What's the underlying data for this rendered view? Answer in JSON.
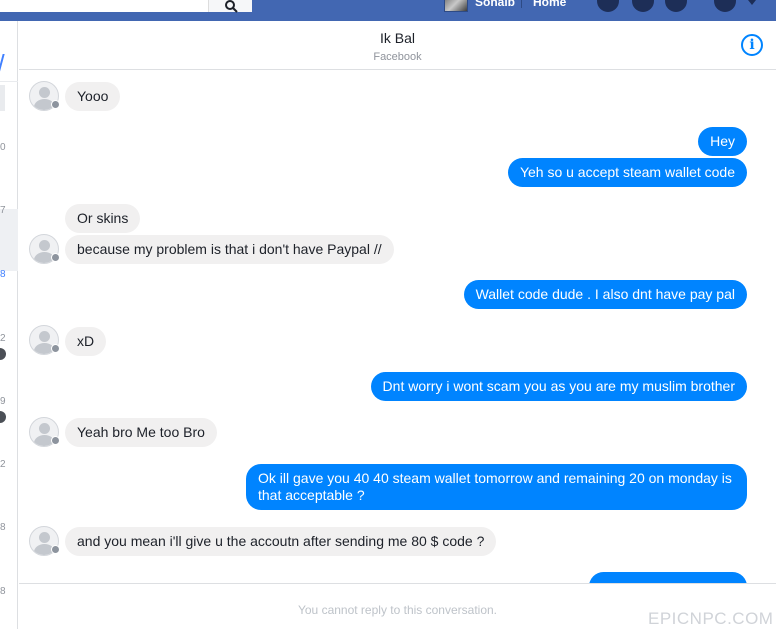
{
  "topbar": {
    "user_name": "Sohaib",
    "home_label": "Home"
  },
  "leftstrip": {
    "numbers": [
      "0",
      "7",
      "8",
      "2",
      "9",
      "2",
      "8",
      "8"
    ]
  },
  "conversation": {
    "contact_name": "Ik Bal",
    "contact_subtitle": "Facebook",
    "info_icon": "i"
  },
  "messages": [
    {
      "direction": "in",
      "text": "Yooo"
    },
    {
      "direction": "out",
      "text": "Hey"
    },
    {
      "direction": "out",
      "text": "Yeh so u accept steam wallet code"
    },
    {
      "direction": "in",
      "text": "Or skins"
    },
    {
      "direction": "in",
      "text": "because my problem is that i don't have Paypal //"
    },
    {
      "direction": "out",
      "text": "Wallet code dude . I also dnt have pay pal"
    },
    {
      "direction": "in",
      "text": "xD"
    },
    {
      "direction": "out",
      "text": "Dnt worry i wont scam you as you are my muslim brother"
    },
    {
      "direction": "in",
      "text": "Yeah bro Me too Bro"
    },
    {
      "direction": "out",
      "text": "Ok ill gave you 40 40 steam wallet tomorrow and remaining 20 on monday is that acceptable ?"
    },
    {
      "direction": "in",
      "text": "and you mean i'll give u the accoutn after sending me 80 $ code ?"
    }
  ],
  "footer": {
    "notice": "You cannot reply to this conversation."
  },
  "watermark": "EPICNPC.COM",
  "colors": {
    "fb_blue": "#4267b2",
    "bubble_out": "#0084ff",
    "bubble_in": "#f1f0f0"
  }
}
